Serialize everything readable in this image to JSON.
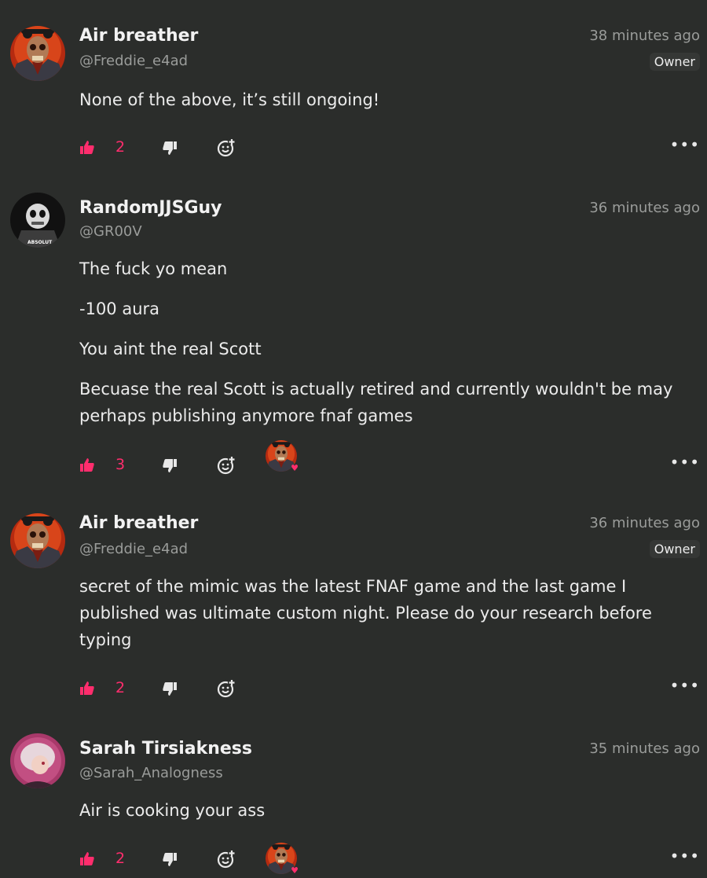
{
  "colors": {
    "background": "#2b2d2b",
    "like_accent": "#ff2d6d",
    "muted": "#9a9c9a"
  },
  "comments": [
    {
      "name": "Air breather",
      "handle": "@Freddie_e4ad",
      "time": "38 minutes ago",
      "badge": "Owner",
      "lines": [
        "None of the above, it’s still ongoing!"
      ],
      "likes": "2"
    },
    {
      "name": "RandomJJSGuy",
      "handle": "@GR00V",
      "time": "36 minutes ago",
      "lines": [
        "The fuck yo mean",
        "-100 aura",
        "You aint the real Scott",
        "Becuase the real Scott is actually retired and currently wouldn't be may perhaps publishing anymore fnaf games"
      ],
      "likes": "3",
      "avatar_text": "ABSOLUT"
    },
    {
      "name": "Air breather",
      "handle": "@Freddie_e4ad",
      "time": "36 minutes ago",
      "badge": "Owner",
      "lines": [
        "secret of the mimic was the latest FNAF game and the last game I published was ultimate custom night. Please do your research before typing"
      ],
      "likes": "2"
    },
    {
      "name": "Sarah Tirsiakness",
      "handle": "@Sarah_Analogness",
      "time": "35 minutes ago",
      "lines": [
        "Air is cooking your ass"
      ],
      "likes": "2"
    }
  ],
  "icons": {
    "like": "thumbs-up-icon",
    "dislike": "thumbs-down-icon",
    "react": "add-reaction-icon",
    "more": "more-options-icon",
    "reaction_heart": "heart-icon"
  }
}
